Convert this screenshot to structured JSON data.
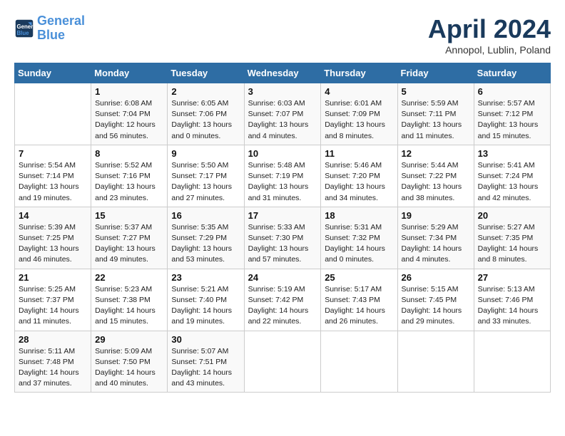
{
  "logo": {
    "line1": "General",
    "line2": "Blue"
  },
  "title": "April 2024",
  "location": "Annopol, Lublin, Poland",
  "weekdays": [
    "Sunday",
    "Monday",
    "Tuesday",
    "Wednesday",
    "Thursday",
    "Friday",
    "Saturday"
  ],
  "weeks": [
    [
      {
        "num": "",
        "info": ""
      },
      {
        "num": "1",
        "info": "Sunrise: 6:08 AM\nSunset: 7:04 PM\nDaylight: 12 hours\nand 56 minutes."
      },
      {
        "num": "2",
        "info": "Sunrise: 6:05 AM\nSunset: 7:06 PM\nDaylight: 13 hours\nand 0 minutes."
      },
      {
        "num": "3",
        "info": "Sunrise: 6:03 AM\nSunset: 7:07 PM\nDaylight: 13 hours\nand 4 minutes."
      },
      {
        "num": "4",
        "info": "Sunrise: 6:01 AM\nSunset: 7:09 PM\nDaylight: 13 hours\nand 8 minutes."
      },
      {
        "num": "5",
        "info": "Sunrise: 5:59 AM\nSunset: 7:11 PM\nDaylight: 13 hours\nand 11 minutes."
      },
      {
        "num": "6",
        "info": "Sunrise: 5:57 AM\nSunset: 7:12 PM\nDaylight: 13 hours\nand 15 minutes."
      }
    ],
    [
      {
        "num": "7",
        "info": "Sunrise: 5:54 AM\nSunset: 7:14 PM\nDaylight: 13 hours\nand 19 minutes."
      },
      {
        "num": "8",
        "info": "Sunrise: 5:52 AM\nSunset: 7:16 PM\nDaylight: 13 hours\nand 23 minutes."
      },
      {
        "num": "9",
        "info": "Sunrise: 5:50 AM\nSunset: 7:17 PM\nDaylight: 13 hours\nand 27 minutes."
      },
      {
        "num": "10",
        "info": "Sunrise: 5:48 AM\nSunset: 7:19 PM\nDaylight: 13 hours\nand 31 minutes."
      },
      {
        "num": "11",
        "info": "Sunrise: 5:46 AM\nSunset: 7:20 PM\nDaylight: 13 hours\nand 34 minutes."
      },
      {
        "num": "12",
        "info": "Sunrise: 5:44 AM\nSunset: 7:22 PM\nDaylight: 13 hours\nand 38 minutes."
      },
      {
        "num": "13",
        "info": "Sunrise: 5:41 AM\nSunset: 7:24 PM\nDaylight: 13 hours\nand 42 minutes."
      }
    ],
    [
      {
        "num": "14",
        "info": "Sunrise: 5:39 AM\nSunset: 7:25 PM\nDaylight: 13 hours\nand 46 minutes."
      },
      {
        "num": "15",
        "info": "Sunrise: 5:37 AM\nSunset: 7:27 PM\nDaylight: 13 hours\nand 49 minutes."
      },
      {
        "num": "16",
        "info": "Sunrise: 5:35 AM\nSunset: 7:29 PM\nDaylight: 13 hours\nand 53 minutes."
      },
      {
        "num": "17",
        "info": "Sunrise: 5:33 AM\nSunset: 7:30 PM\nDaylight: 13 hours\nand 57 minutes."
      },
      {
        "num": "18",
        "info": "Sunrise: 5:31 AM\nSunset: 7:32 PM\nDaylight: 14 hours\nand 0 minutes."
      },
      {
        "num": "19",
        "info": "Sunrise: 5:29 AM\nSunset: 7:34 PM\nDaylight: 14 hours\nand 4 minutes."
      },
      {
        "num": "20",
        "info": "Sunrise: 5:27 AM\nSunset: 7:35 PM\nDaylight: 14 hours\nand 8 minutes."
      }
    ],
    [
      {
        "num": "21",
        "info": "Sunrise: 5:25 AM\nSunset: 7:37 PM\nDaylight: 14 hours\nand 11 minutes."
      },
      {
        "num": "22",
        "info": "Sunrise: 5:23 AM\nSunset: 7:38 PM\nDaylight: 14 hours\nand 15 minutes."
      },
      {
        "num": "23",
        "info": "Sunrise: 5:21 AM\nSunset: 7:40 PM\nDaylight: 14 hours\nand 19 minutes."
      },
      {
        "num": "24",
        "info": "Sunrise: 5:19 AM\nSunset: 7:42 PM\nDaylight: 14 hours\nand 22 minutes."
      },
      {
        "num": "25",
        "info": "Sunrise: 5:17 AM\nSunset: 7:43 PM\nDaylight: 14 hours\nand 26 minutes."
      },
      {
        "num": "26",
        "info": "Sunrise: 5:15 AM\nSunset: 7:45 PM\nDaylight: 14 hours\nand 29 minutes."
      },
      {
        "num": "27",
        "info": "Sunrise: 5:13 AM\nSunset: 7:46 PM\nDaylight: 14 hours\nand 33 minutes."
      }
    ],
    [
      {
        "num": "28",
        "info": "Sunrise: 5:11 AM\nSunset: 7:48 PM\nDaylight: 14 hours\nand 37 minutes."
      },
      {
        "num": "29",
        "info": "Sunrise: 5:09 AM\nSunset: 7:50 PM\nDaylight: 14 hours\nand 40 minutes."
      },
      {
        "num": "30",
        "info": "Sunrise: 5:07 AM\nSunset: 7:51 PM\nDaylight: 14 hours\nand 43 minutes."
      },
      {
        "num": "",
        "info": ""
      },
      {
        "num": "",
        "info": ""
      },
      {
        "num": "",
        "info": ""
      },
      {
        "num": "",
        "info": ""
      }
    ]
  ]
}
